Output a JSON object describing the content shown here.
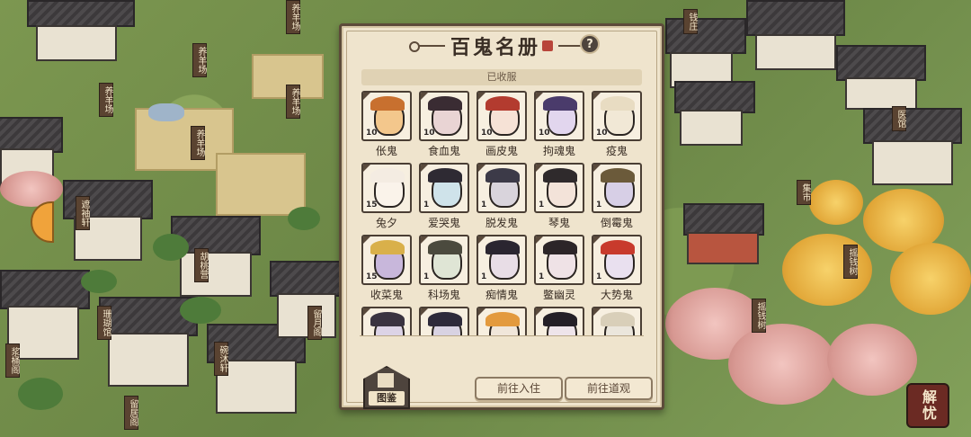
{
  "panel": {
    "title": "百鬼名册",
    "help_icon": "?",
    "section_label": "已收服",
    "ghosts": [
      {
        "name": "伥鬼",
        "level": "10",
        "face": "#f3c78c",
        "hair": "#c8702f"
      },
      {
        "name": "食血鬼",
        "level": "10",
        "face": "#e9d4d4",
        "hair": "#3a2c33"
      },
      {
        "name": "画皮鬼",
        "level": "10",
        "face": "#f6e2d6",
        "hair": "#b33b2f"
      },
      {
        "name": "拘魂鬼",
        "level": "10",
        "face": "#e2d6ee",
        "hair": "#4a3b6b"
      },
      {
        "name": "疫鬼",
        "level": "10",
        "face": "#f1e8d6",
        "hair": "#e8dcc2"
      },
      {
        "name": "兔夕",
        "level": "15",
        "face": "#faf3ea",
        "hair": "#f4ece2"
      },
      {
        "name": "爱哭鬼",
        "level": "1",
        "face": "#cfe3ea",
        "hair": "#2e2a33"
      },
      {
        "name": "脱发鬼",
        "level": "1",
        "face": "#d9d4dc",
        "hair": "#3c3a48"
      },
      {
        "name": "琴鬼",
        "level": "1",
        "face": "#f3e3d9",
        "hair": "#2f2a2c"
      },
      {
        "name": "倒霉鬼",
        "level": "1",
        "face": "#d7cfe6",
        "hair": "#6b5a3a"
      },
      {
        "name": "收菜鬼",
        "level": "15",
        "face": "#c8b7db",
        "hair": "#d9b04a"
      },
      {
        "name": "科场鬼",
        "level": "1",
        "face": "#dfe5d5",
        "hair": "#4b4a3e"
      },
      {
        "name": "痴情鬼",
        "level": "1",
        "face": "#e8dde6",
        "hair": "#2a2530"
      },
      {
        "name": "鳖幽灵",
        "level": "1",
        "face": "#efe2e6",
        "hair": "#2c2528"
      },
      {
        "name": "大势鬼",
        "level": "1",
        "face": "#e9e0ef",
        "hair": "#c83a2c"
      },
      {
        "name": "",
        "level": "",
        "face": "#dcd3e6",
        "hair": "#3a3340"
      },
      {
        "name": "",
        "level": "",
        "face": "#d8d2e2",
        "hair": "#2e2a3a"
      },
      {
        "name": "",
        "level": "",
        "face": "#f0e6da",
        "hair": "#e39a3e"
      },
      {
        "name": "",
        "level": "",
        "face": "#eee4ea",
        "hair": "#241f26"
      },
      {
        "name": "",
        "level": "",
        "face": "#ebe6dc",
        "hair": "#d9cfb9"
      }
    ],
    "album_label": "图鉴",
    "goto_residence": "前往入住",
    "goto_temple": "前往道观"
  },
  "scene": {
    "signs": [
      "养羊场",
      "养羊场",
      "养羊场",
      "养羊场",
      "养羊场",
      "医馆",
      "钱庄",
      "集市",
      "摇钱树",
      "摇钱树",
      "胡桃营",
      "遮袖轩",
      "珊瑚馆",
      "留月阁",
      "留居阁",
      "碗沐轩",
      "浆桶阁"
    ],
    "corner_button": "解忧"
  },
  "colors": {
    "panel_bg": "#efe4cd",
    "panel_border": "#5d4b3a",
    "title_text": "#3a2e25"
  }
}
